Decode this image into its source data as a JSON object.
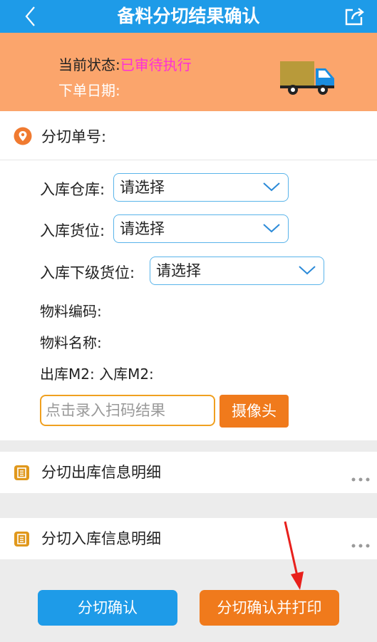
{
  "header": {
    "title": "备料分切结果确认"
  },
  "status": {
    "state_label": "当前状态:",
    "state_value": "已审待执行",
    "date_label": "下单日期:"
  },
  "order": {
    "label": "分切单号:"
  },
  "form": {
    "warehouse_label": "入库仓库:",
    "warehouse_value": "请选择",
    "location_label": "入库货位:",
    "location_value": "请选择",
    "sublocation_label": "入库下级货位:",
    "sublocation_value": "请选择",
    "material_code_label": "物料编码:",
    "material_name_label": "物料名称:",
    "out_m2_label": "出库M2:",
    "in_m2_label": "入库M2:",
    "scan_placeholder": "点击录入扫码结果",
    "camera_label": "摄像头"
  },
  "sections": {
    "out_detail": "分切出库信息明细",
    "in_detail": "分切入库信息明细"
  },
  "actions": {
    "confirm": "分切确认",
    "confirm_print": "分切确认并打印"
  },
  "colors": {
    "header": "#1e9be8",
    "status_bg": "#fba56c",
    "status_value": "#ff2fd6",
    "accent_orange": "#f07a1c",
    "select_border": "#5ab4ea"
  },
  "icons": [
    "back-icon",
    "share-icon",
    "truck-icon",
    "location-pin-icon",
    "chevron-down-icon",
    "list-icon",
    "more-icon"
  ]
}
